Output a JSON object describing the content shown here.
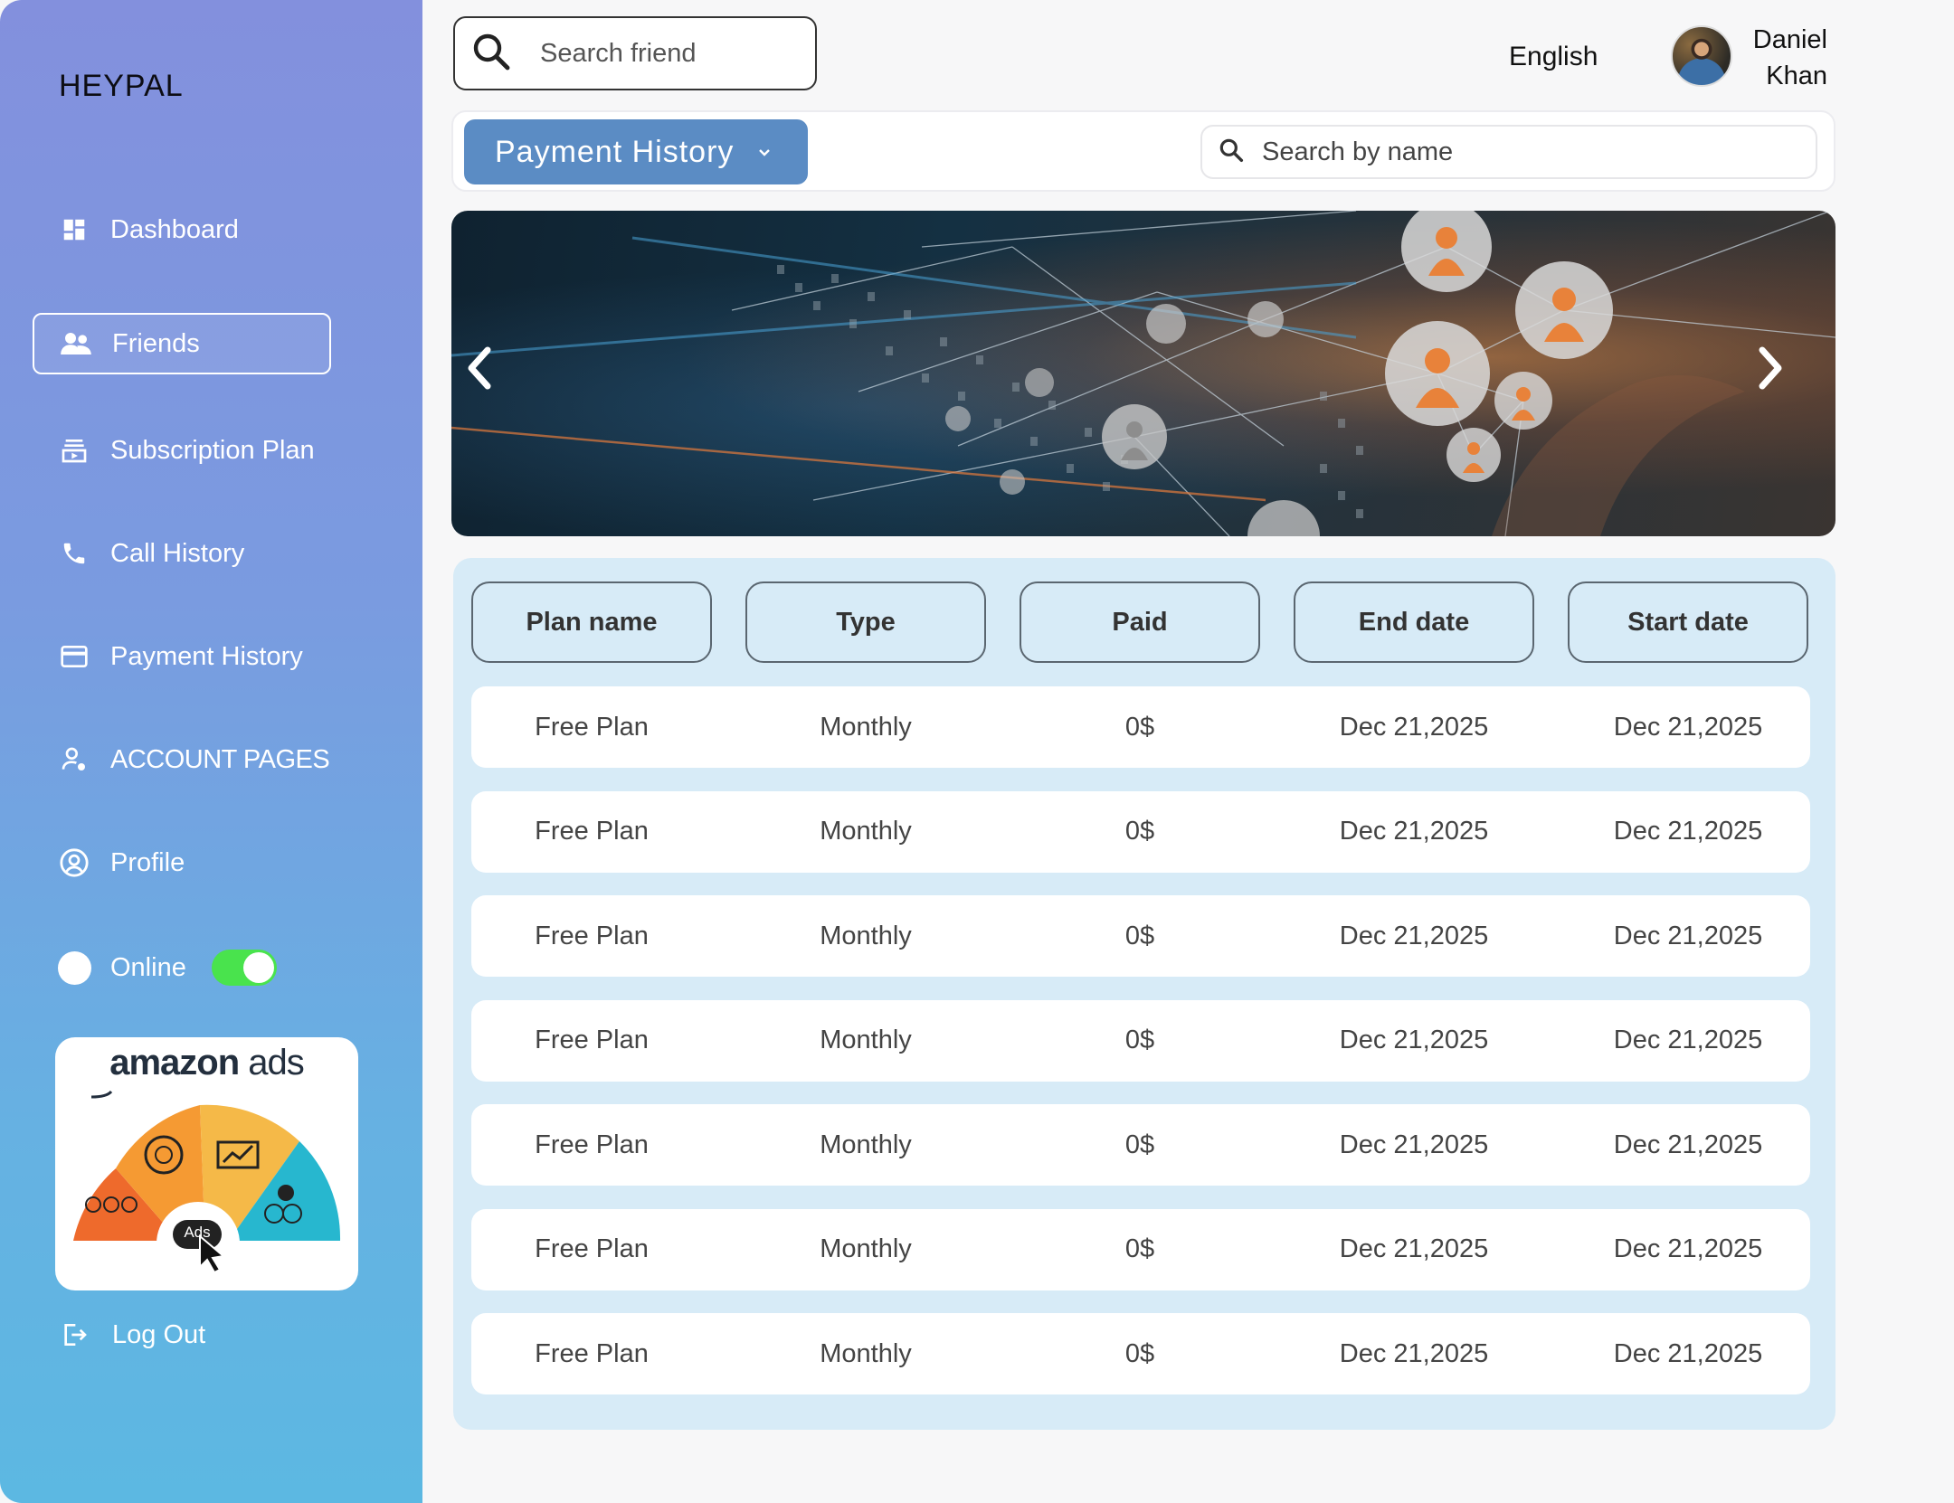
{
  "brand": "HEYPAL",
  "sidebar": {
    "items": [
      {
        "label": "Dashboard",
        "icon": "dashboard-icon"
      },
      {
        "label": "Friends",
        "icon": "friends-icon"
      },
      {
        "label": "Subscription Plan",
        "icon": "subscription-icon"
      },
      {
        "label": "Call History",
        "icon": "phone-icon"
      },
      {
        "label": "Payment History",
        "icon": "credit-card-icon"
      },
      {
        "label": "ACCOUNT PAGES",
        "icon": "account-pages-icon"
      },
      {
        "label": "Profile",
        "icon": "profile-icon"
      }
    ],
    "active_item": "Friends",
    "online_label": "Online",
    "online_enabled": true,
    "logout_label": "Log Out"
  },
  "ad": {
    "brand_bold": "amazon",
    "brand_light": "ads",
    "badge": "Ads"
  },
  "topbar": {
    "search_placeholder": "Search friend",
    "language": "English",
    "user_first": "Daniel",
    "user_last": "Khan"
  },
  "subheader": {
    "dropdown_label": "Payment History",
    "search_placeholder": "Search by name"
  },
  "table": {
    "columns": [
      "Plan name",
      "Type",
      "Paid",
      "End date",
      "Start date"
    ],
    "rows": [
      [
        "Free Plan",
        "Monthly",
        "0$",
        "Dec 21,2025",
        "Dec 21,2025"
      ],
      [
        "Free Plan",
        "Monthly",
        "0$",
        "Dec 21,2025",
        "Dec 21,2025"
      ],
      [
        "Free Plan",
        "Monthly",
        "0$",
        "Dec 21,2025",
        "Dec 21,2025"
      ],
      [
        "Free Plan",
        "Monthly",
        "0$",
        "Dec 21,2025",
        "Dec 21,2025"
      ],
      [
        "Free Plan",
        "Monthly",
        "0$",
        "Dec 21,2025",
        "Dec 21,2025"
      ],
      [
        "Free Plan",
        "Monthly",
        "0$",
        "Dec 21,2025",
        "Dec 21,2025"
      ],
      [
        "Free Plan",
        "Monthly",
        "0$",
        "Dec 21,2025",
        "Dec 21,2025"
      ]
    ]
  },
  "colors": {
    "accent": "#5b8cc4",
    "toggle_on": "#49e34d",
    "table_bg": "#d7ebf7"
  }
}
